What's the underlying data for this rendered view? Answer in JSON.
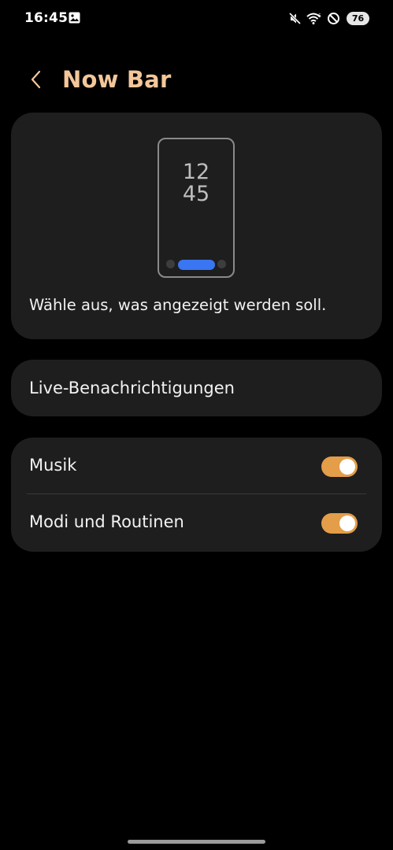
{
  "status_bar": {
    "time": "16:45",
    "battery": "76",
    "icons": [
      "gallery-icon",
      "mute-icon",
      "wifi-icon",
      "do-not-disturb-icon",
      "battery-icon"
    ]
  },
  "header": {
    "title": "Now Bar",
    "back_icon": "chevron-left-icon"
  },
  "preview": {
    "clock_hours": "12",
    "clock_minutes": "45",
    "caption": "Wähle aus, was angezeigt werden soll."
  },
  "items": {
    "live_notifications": "Live-Benachrichtigungen",
    "music": {
      "label": "Musik",
      "enabled": true
    },
    "modes_routines": {
      "label": "Modi und Routinen",
      "enabled": true
    }
  },
  "colors": {
    "accent": "#f3c79b",
    "switch_on": "#e49d48",
    "card_bg": "#1e1e1e",
    "nowbar_pill": "#3a75f2"
  }
}
